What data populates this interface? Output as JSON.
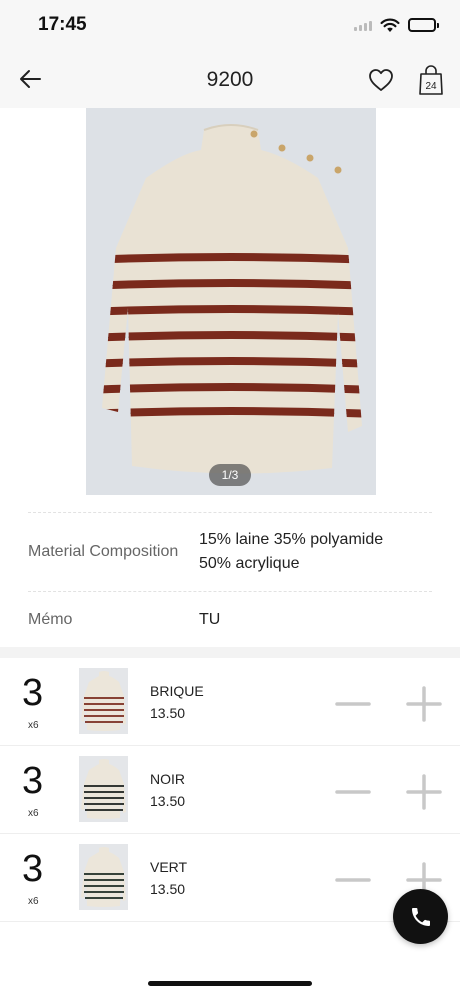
{
  "status_bar": {
    "time": "17:45"
  },
  "header": {
    "title": "9200",
    "cart_count": "24"
  },
  "gallery": {
    "counter": "1/3"
  },
  "attributes": [
    {
      "label": "Material Composition",
      "value_line1": "15% laine 35% polyamide",
      "value_line2": "50% acrylique"
    },
    {
      "label": "Mémo",
      "value": "TU"
    }
  ],
  "variants": [
    {
      "qty": "3",
      "multiplier": "x6",
      "name": "BRIQUE",
      "price": "13.50",
      "stripe_color": "#7a2a1c"
    },
    {
      "qty": "3",
      "multiplier": "x6",
      "name": "NOIR",
      "price": "13.50",
      "stripe_color": "#1a1f1c"
    },
    {
      "qty": "3",
      "multiplier": "x6",
      "name": "VERT",
      "price": "13.50",
      "stripe_color": "#1c2a22"
    }
  ],
  "colors": {
    "accent": "#111111",
    "sweater_body": "#e8e1d3",
    "stripe_main": "#7a2a1c"
  }
}
